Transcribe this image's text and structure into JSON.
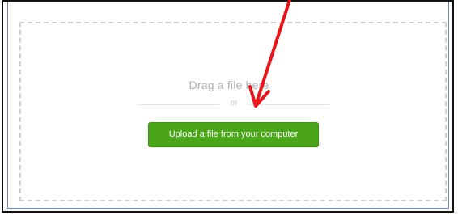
{
  "dropzone": {
    "drag_label": "Drag a file here",
    "or_label": "or",
    "upload_button_label": "Upload a file from your computer"
  },
  "colors": {
    "upload_button": "#4aa51a",
    "annotation_arrow": "#e8141a",
    "dashed_border": "#cfcfcf",
    "frame_blue": "#6a8cc7"
  },
  "annotation": {
    "icon": "red-arrow-icon"
  }
}
